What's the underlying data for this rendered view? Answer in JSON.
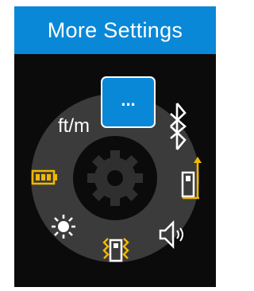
{
  "header": {
    "title": "More Settings"
  },
  "menu": {
    "more_label": "...",
    "unit_label": "ft/m",
    "items": [
      {
        "name": "more",
        "icon": "ellipsis-icon",
        "selected": true
      },
      {
        "name": "bluetooth",
        "icon": "bluetooth-icon"
      },
      {
        "name": "reference-point",
        "icon": "reference-point-icon"
      },
      {
        "name": "sound",
        "icon": "speaker-icon"
      },
      {
        "name": "display-rotation",
        "icon": "display-rotation-icon"
      },
      {
        "name": "brightness",
        "icon": "brightness-icon"
      },
      {
        "name": "battery",
        "icon": "battery-icon"
      },
      {
        "name": "units",
        "icon": "units-text"
      }
    ],
    "center_icon": "gear-icon"
  },
  "colors": {
    "title_bar": "#0a88d8",
    "selection": "#0a88d8",
    "ring": "#3b3b3b",
    "background": "#0b0b0b",
    "accent_yellow": "#f1b800",
    "icon_white": "#ffffff"
  }
}
